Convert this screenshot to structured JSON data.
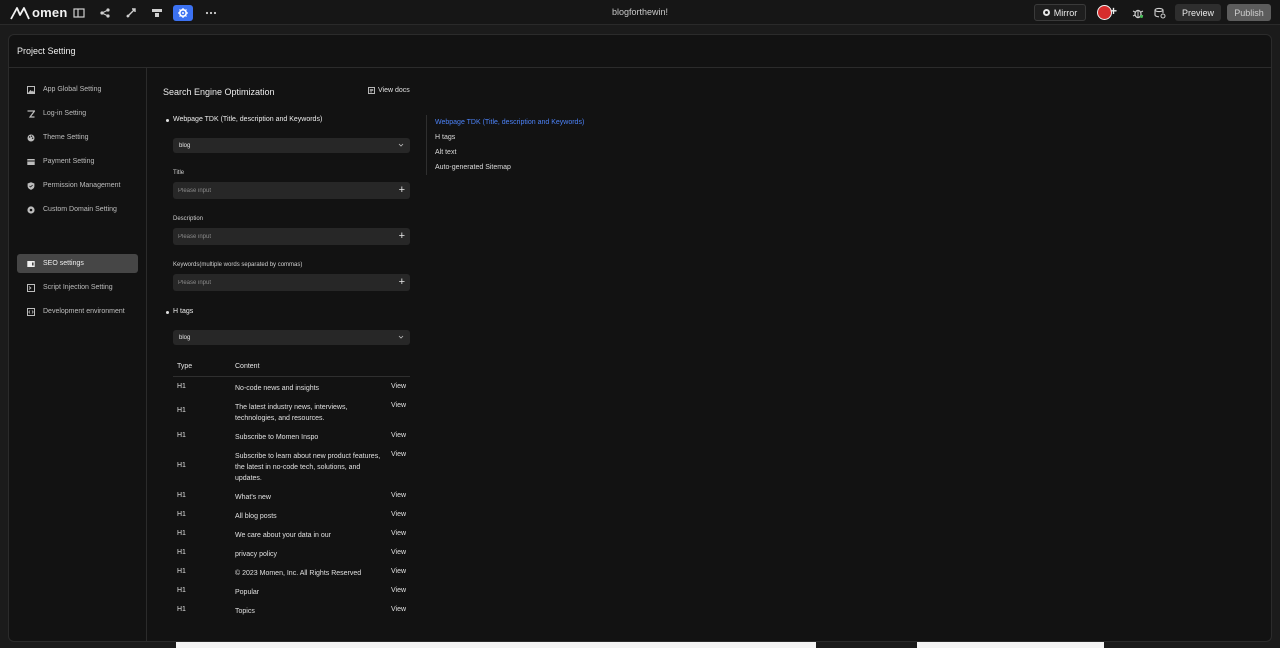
{
  "topbar": {
    "logo_text": "omen",
    "doc_title": "blogforthewin!",
    "mirror_label": "Mirror",
    "preview_label": "Preview",
    "publish_label": "Publish"
  },
  "colors": {
    "accent": "#3c72f2",
    "active_anchor": "#4c82f7",
    "avatar": "#d62c2c"
  },
  "modal": {
    "title": "Project Setting"
  },
  "sidebar": {
    "items": [
      {
        "label": "App Global Setting",
        "icon": "image-icon"
      },
      {
        "label": "Log-in Setting",
        "icon": "key-icon"
      },
      {
        "label": "Theme Setting",
        "icon": "palette-icon"
      },
      {
        "label": "Payment Setting",
        "icon": "card-icon"
      },
      {
        "label": "Permission Management",
        "icon": "shield-icon"
      },
      {
        "label": "Custom Domain Setting",
        "icon": "domain-icon"
      },
      {
        "label": "SEO settings",
        "icon": "seo-icon",
        "active": true
      },
      {
        "label": "Script Injection Setting",
        "icon": "terminal-icon"
      },
      {
        "label": "Development environment",
        "icon": "dev-icon"
      }
    ]
  },
  "main": {
    "section_title": "Search Engine Optimization",
    "view_docs": "View docs",
    "tdk": {
      "title": "Webpage TDK (Title, description and Keywords)",
      "page_select": "blog",
      "title_label": "Title",
      "title_placeholder": "Please input",
      "description_label": "Description",
      "description_placeholder": "Please input",
      "keywords_label": "Keywords(multiple words separated by commas)",
      "keywords_placeholder": "Please input"
    },
    "htags": {
      "title": "H tags",
      "page_select": "blog",
      "col_type": "Type",
      "col_content": "Content",
      "rows": [
        {
          "type": "H1",
          "content": "No-code news and insights",
          "action": "View"
        },
        {
          "type": "H1",
          "content": "The latest industry news, interviews, technologies, and resources.",
          "action": "View"
        },
        {
          "type": "H1",
          "content": "Subscribe to Momen Inspo",
          "action": "View"
        },
        {
          "type": "H1",
          "content": "Subscribe to learn about new product features, the latest in no-code tech, solutions, and updates.",
          "action": "View"
        },
        {
          "type": "H1",
          "content": "What's new",
          "action": "View"
        },
        {
          "type": "H1",
          "content": "All blog posts",
          "action": "View"
        },
        {
          "type": "H1",
          "content": "We care about your data in our",
          "action": "View"
        },
        {
          "type": "H1",
          "content": "privacy policy",
          "action": "View"
        },
        {
          "type": "H1",
          "content": "© 2023 Momen, Inc. All Rights Reserved",
          "action": "View"
        },
        {
          "type": "H1",
          "content": "Popular",
          "action": "View"
        },
        {
          "type": "H1",
          "content": "Topics",
          "action": "View"
        }
      ]
    }
  },
  "anchor_nav": {
    "items": [
      {
        "label": "Webpage TDK (Title, description and Keywords)",
        "active": true
      },
      {
        "label": "H tags"
      },
      {
        "label": "Alt text"
      },
      {
        "label": "Auto-generated Sitemap"
      }
    ]
  }
}
